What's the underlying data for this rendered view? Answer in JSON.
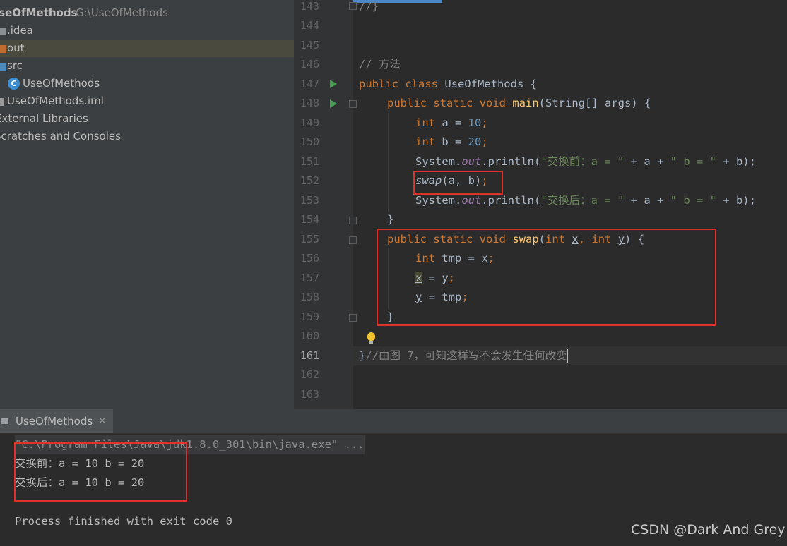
{
  "project": {
    "root_name": "UseOfMethods",
    "root_path": "G:\\UseOfMethods",
    "items": [
      {
        "label": ".idea",
        "icon": "folder-icon",
        "color": "#8a8f94"
      },
      {
        "label": "out",
        "icon": "folder-icon",
        "color": "#c26b2f",
        "selected": true
      },
      {
        "label": "src",
        "icon": "folder-icon",
        "color": "#4b8bbe"
      },
      {
        "label": "UseOfMethods",
        "icon": "java-class-icon"
      },
      {
        "label": "UseOfMethods.iml",
        "icon": "file-icon"
      },
      {
        "label": "External Libraries",
        "icon": "library-icon"
      },
      {
        "label": "Scratches and Consoles",
        "icon": "scratches-icon"
      }
    ]
  },
  "editor": {
    "line_numbers": [
      "143",
      "144",
      "145",
      "146",
      "147",
      "148",
      "149",
      "150",
      "151",
      "152",
      "153",
      "154",
      "155",
      "156",
      "157",
      "158",
      "159",
      "160",
      "161",
      "162",
      "163"
    ],
    "current_line": "161",
    "lines": {
      "l143": {
        "t1": "//}"
      },
      "l146": {
        "comment": "// 方法"
      },
      "l147": {
        "kw": "public class",
        "rest": " UseOfMethods {"
      },
      "l148": {
        "kw": "public static void",
        "fn": "main",
        "rest": "(String[] args) {"
      },
      "l149": {
        "kw": "int",
        "mid": " a = ",
        "num": "10",
        "end": ";"
      },
      "l150": {
        "kw": "int",
        "mid": " b = ",
        "num": "20",
        "end": ";"
      },
      "l151": {
        "a": "System.",
        "field": "out",
        "b": ".println(",
        "s1": "\"交换前：a = \"",
        "c": " + a + ",
        "s2": "\" b = \"",
        "d": " + b);"
      },
      "l152": {
        "call": "swap",
        "rest": "(a, b)",
        "end": ";"
      },
      "l153": {
        "a": "System.",
        "field": "out",
        "b": ".println(",
        "s1": "\"交换后：a = \"",
        "c": " + a + ",
        "s2": "\" b = \"",
        "d": " + b);"
      },
      "l154": {
        "t1": "}"
      },
      "l155": {
        "kw": "public static void",
        "fn": "swap",
        "p1": "(",
        "int1": "int",
        "x": "x",
        "comma": ", ",
        "int2": "int",
        "y": "y",
        "p2": ") {"
      },
      "l156": {
        "kw": "int",
        "rest": " tmp = x",
        "end": ";"
      },
      "l157": {
        "x": "x",
        "rest": " = y",
        "end": ";"
      },
      "l158": {
        "y": "y",
        "rest": " = tmp",
        "end": ";"
      },
      "l159": {
        "t1": "}"
      },
      "l161": {
        "brace": "}",
        "comment": "//由图 7，可知这样写不会发生任何改变"
      }
    }
  },
  "run": {
    "tab_label": "UseOfMethods",
    "command": "\"C:\\Program Files\\Java\\jdk1.8.0_301\\bin\\java.exe\" ...",
    "output": [
      "交换前：a = 10 b = 20",
      "交换后：a = 10 b = 20"
    ],
    "finish": "Process finished with exit code 0"
  },
  "watermark": "CSDN @Dark And Grey",
  "colors": {
    "highlight_box": "#e0312b",
    "run_arrow": "#499c54",
    "keyword": "#cc7832",
    "number": "#6897bb",
    "string": "#6a8759"
  }
}
